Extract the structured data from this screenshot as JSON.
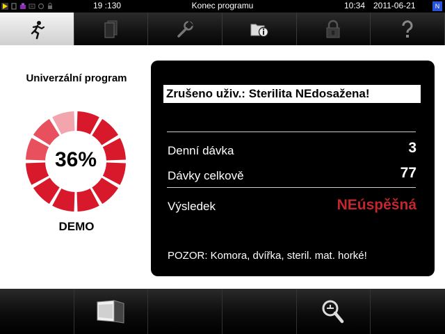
{
  "status_bar": {
    "batch_counter": "19 :130",
    "title": "Konec programu",
    "time": "10:34",
    "date": "2011-06-21",
    "flag_symbol": "N",
    "icons": [
      "play-icon",
      "device-icon",
      "printer-icon",
      "network-icon",
      "lock-icon"
    ]
  },
  "tabs": [
    {
      "name": "program-run",
      "icon": "running-person-icon",
      "active": true
    },
    {
      "name": "documents",
      "icon": "documents-icon",
      "active": false
    },
    {
      "name": "settings",
      "icon": "wrench-icon",
      "active": false
    },
    {
      "name": "info",
      "icon": "folder-info-icon",
      "active": false
    },
    {
      "name": "lock",
      "icon": "padlock-icon",
      "active": false
    },
    {
      "name": "help",
      "icon": "help-icon",
      "active": false
    }
  ],
  "program": {
    "name": "Univerzální program",
    "progress_percent": 36,
    "progress_label": "36%",
    "mode_label": "DEMO",
    "ring_colors": {
      "done": "#d8192b",
      "mid": "#e8505e",
      "light": "#f2a5ad"
    }
  },
  "result": {
    "message": "Zrušeno uživ.: Sterilita NEdosažena!",
    "daily_batch_label": "Denní dávka",
    "daily_batch_value": "3",
    "total_batches_label": "Dávky celkově",
    "total_batches_value": "77",
    "result_label": "Výsledek",
    "result_value": "NEúspěšná",
    "result_color": "#c1272d",
    "warning": "POZOR: Komora, dvířka, steril. mat. horké!"
  },
  "bottom_bar": {
    "door_button_icon": "door-open-icon",
    "zoom_button_icon": "magnifier-icon"
  }
}
